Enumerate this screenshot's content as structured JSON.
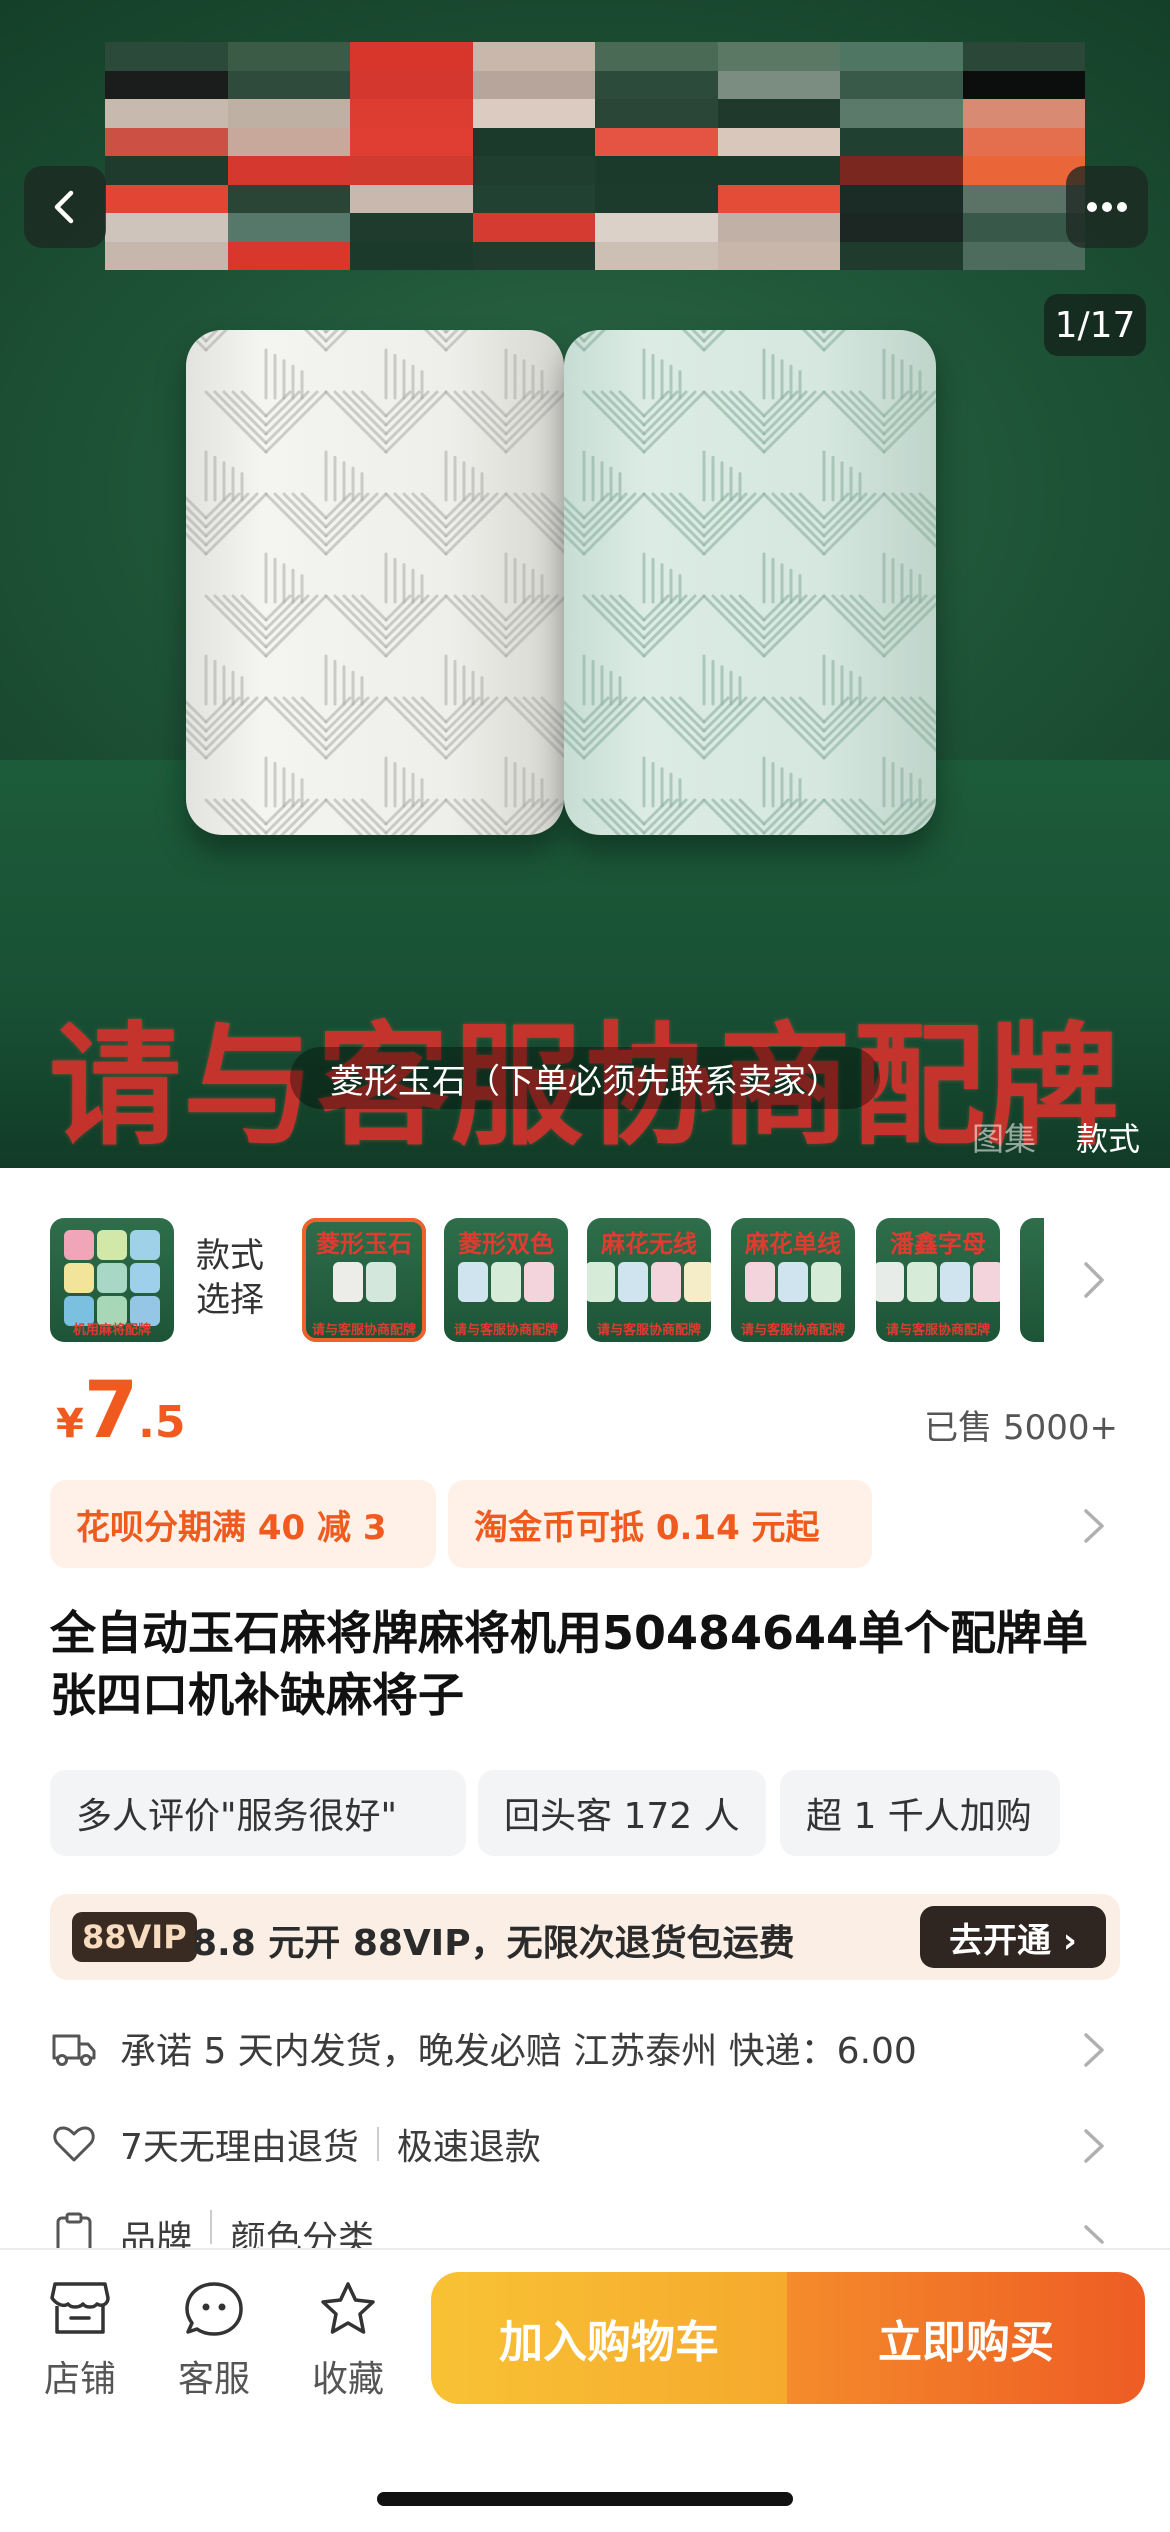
{
  "hero": {
    "counter": "1/17",
    "watermark": "请与客服协商配牌",
    "caption": "菱形玉石（下单必须先联系卖家）",
    "tab_gallery": "图集",
    "tab_style": "款式",
    "mosaic_colors": [
      "#2c4a39",
      "#3b5b47",
      "#d8352b",
      "#c9b7ab",
      "#4a6a55",
      "#5a7863",
      "#4f7663",
      "#2b4738",
      "#1a1d1c",
      "#2f4b3b",
      "#d3372d",
      "#b7a49a",
      "#2c4b3b",
      "#7a8d80",
      "#3a5a49",
      "#0c0d0d",
      "#c8b9ae",
      "#bfb0a4",
      "#dd3c31",
      "#dccbc0",
      "#2a4636",
      "#1f3a2c",
      "#5c7a69",
      "#d98a73",
      "#cc5144",
      "#c9a89c",
      "#e03e33",
      "#1c3a2b",
      "#e55343",
      "#d9c7bb",
      "#204032",
      "#e36f4e",
      "#1f3b2d",
      "#d4382e",
      "#d13a2f",
      "#203e2f",
      "#1c3a2b",
      "#1b3a2b",
      "#7a2720",
      "#ea6538",
      "#e24533",
      "#2a4536",
      "#c9b8ad",
      "#214132",
      "#1d3b2c",
      "#e44c37",
      "#1b2b25",
      "#5b7366",
      "#cfc4bb",
      "#56786a",
      "#1e3b2d",
      "#d53b30",
      "#dcd1c8",
      "#c0b0a6",
      "#1c2724",
      "#38584a",
      "#c6b6ab",
      "#d9362c",
      "#1c3a2b",
      "#1f3c2e",
      "#ccbfb4",
      "#c8b6aa",
      "#1e3b2d",
      "#4d6c5d"
    ]
  },
  "variants": {
    "style_select": "款式选择",
    "items": [
      {
        "label": "",
        "foot": "机用麻将配牌",
        "tiles": [
          "#f0a6b8",
          "#d2e8a8",
          "#9fd1e8",
          "#f2e49a",
          "#a9d7c6",
          "#9ed0ec",
          "#7cc0e0",
          "#a7d7b7",
          "#96c6e6"
        ]
      },
      {
        "label": "菱形玉石",
        "foot": "请与客服协商配牌",
        "tiles": [
          "#ecece8",
          "#d3e7dd"
        ]
      },
      {
        "label": "菱形双色",
        "foot": "请与客服协商配牌",
        "tiles": [
          "#cfe4ef",
          "#d6ecd8",
          "#f3d4dc"
        ]
      },
      {
        "label": "麻花无线",
        "foot": "请与客服协商配牌",
        "tiles": [
          "#d6ecd8",
          "#cfe4ef",
          "#f3d4dc",
          "#f5ecc8"
        ]
      },
      {
        "label": "麻花单线",
        "foot": "请与客服协商配牌",
        "tiles": [
          "#f3d4dc",
          "#cfe4ef",
          "#d6ecd8"
        ]
      },
      {
        "label": "潘鑫字母",
        "foot": "请与客服协商配牌",
        "tiles": [
          "#e8ece8",
          "#d6ecd8",
          "#cfe4ef",
          "#f3d4dc"
        ]
      }
    ]
  },
  "price": {
    "currency": "¥",
    "integer": "7",
    "decimal": ".5"
  },
  "sold": "已售 5000+",
  "promos": [
    "花呗分期满 40 减 3",
    "淘金币可抵 0.14 元起"
  ],
  "title": "全自动玉石麻将牌麻将机用50484644单个配牌单张四口机补缺麻将子",
  "tags": [
    "多人评价\"服务很好\"",
    "回头客 172 人",
    "超 1 千人加购"
  ],
  "vip": {
    "badge": "88VIP",
    "text": "8.8 元开 88VIP，无限次退货包运费",
    "button": "去开通 ›"
  },
  "rows": {
    "shipping": "承诺 5 天内发货，晚发必赔  江苏泰州  快递：6.00",
    "returns_a": "7天无理由退货",
    "returns_b": "极速退款",
    "params_a": "品牌",
    "params_b": "颜色分类"
  },
  "bottom": {
    "store": "店铺",
    "service": "客服",
    "favorite": "收藏",
    "cart": "加入购物车",
    "buy": "立即购买"
  },
  "colors": {
    "accent": "#f05a1e",
    "cart_start": "#f8c235",
    "buy_end": "#ee5c24"
  }
}
